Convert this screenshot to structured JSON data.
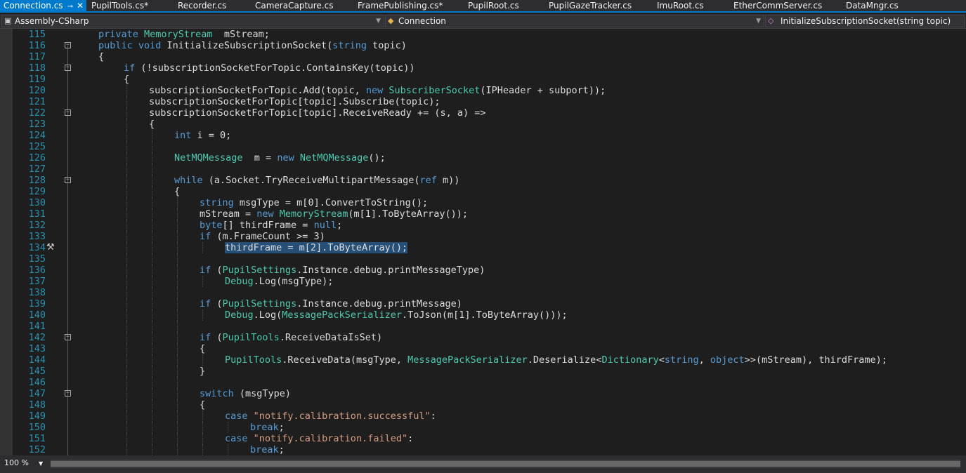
{
  "tabs": [
    {
      "label": "Connection.cs",
      "active": true
    },
    {
      "label": "PupilTools.cs*"
    },
    {
      "label": "Recorder.cs"
    },
    {
      "label": "CameraCapture.cs"
    },
    {
      "label": "FramePublishing.cs*"
    },
    {
      "label": "PupilRoot.cs"
    },
    {
      "label": "PupilGazeTracker.cs"
    },
    {
      "label": "ImuRoot.cs"
    },
    {
      "label": "EtherCommServer.cs"
    },
    {
      "label": "DataMngr.cs"
    }
  ],
  "tab_pin_glyph": "⊸",
  "tab_close_glyph": "✕",
  "navbar": {
    "project": "Assembly-CSharp",
    "class": "Connection",
    "member": "InitializeSubscriptionSocket(string topic)"
  },
  "lines": [
    {
      "n": "115",
      "i": 0,
      "t": [
        [
          "kw",
          "private "
        ],
        [
          "ty",
          "MemoryStream"
        ],
        [
          "",
          "  mStream;"
        ]
      ]
    },
    {
      "n": "116",
      "i": 0,
      "fold": true,
      "t": [
        [
          "kw",
          "public "
        ],
        [
          "kw",
          "void "
        ],
        [
          "",
          "InitializeSubscriptionSocket("
        ],
        [
          "kw",
          "string "
        ],
        [
          "",
          "topic)"
        ]
      ]
    },
    {
      "n": "117",
      "i": 0,
      "t": [
        [
          "",
          "{"
        ]
      ]
    },
    {
      "n": "118",
      "i": 1,
      "fold": true,
      "t": [
        [
          "kw",
          "if "
        ],
        [
          "",
          "(!subscriptionSocketForTopic.ContainsKey(topic))"
        ]
      ]
    },
    {
      "n": "119",
      "i": 1,
      "t": [
        [
          "",
          "{"
        ]
      ]
    },
    {
      "n": "120",
      "i": 2,
      "t": [
        [
          "",
          "subscriptionSocketForTopic.Add(topic, "
        ],
        [
          "kw",
          "new "
        ],
        [
          "ty",
          "SubscriberSocket"
        ],
        [
          "",
          "(IPHeader + subport));"
        ]
      ]
    },
    {
      "n": "121",
      "i": 2,
      "t": [
        [
          "",
          "subscriptionSocketForTopic[topic].Subscribe(topic);"
        ]
      ]
    },
    {
      "n": "122",
      "i": 2,
      "fold": true,
      "t": [
        [
          "",
          "subscriptionSocketForTopic[topic].ReceiveReady += (s, a) =>"
        ]
      ]
    },
    {
      "n": "123",
      "i": 2,
      "t": [
        [
          "",
          "{"
        ]
      ]
    },
    {
      "n": "124",
      "i": 3,
      "t": [
        [
          "kw",
          "int "
        ],
        [
          "",
          "i = 0;"
        ]
      ]
    },
    {
      "n": "125",
      "i": 3,
      "t": []
    },
    {
      "n": "126",
      "i": 3,
      "t": [
        [
          "ty",
          "NetMQMessage"
        ],
        [
          "",
          "  m = "
        ],
        [
          "kw",
          "new "
        ],
        [
          "ty",
          "NetMQMessage"
        ],
        [
          "",
          "();"
        ]
      ]
    },
    {
      "n": "127",
      "i": 3,
      "t": []
    },
    {
      "n": "128",
      "i": 3,
      "fold": true,
      "t": [
        [
          "kw",
          "while "
        ],
        [
          "",
          "(a.Socket.TryReceiveMultipartMessage("
        ],
        [
          "kw",
          "ref "
        ],
        [
          "",
          "m))"
        ]
      ]
    },
    {
      "n": "129",
      "i": 3,
      "t": [
        [
          "",
          "{"
        ]
      ]
    },
    {
      "n": "130",
      "i": 4,
      "t": [
        [
          "kw",
          "string "
        ],
        [
          "",
          "msgType = m[0].ConvertToString();"
        ]
      ]
    },
    {
      "n": "131",
      "i": 4,
      "t": [
        [
          "",
          "mStream = "
        ],
        [
          "kw",
          "new "
        ],
        [
          "ty",
          "MemoryStream"
        ],
        [
          "",
          "(m[1].ToByteArray());"
        ]
      ]
    },
    {
      "n": "132",
      "i": 4,
      "t": [
        [
          "kw",
          "byte"
        ],
        [
          "",
          "[] thirdFrame = "
        ],
        [
          "kw",
          "null"
        ],
        [
          ";"
        ]
      ]
    },
    {
      "n": "133",
      "i": 4,
      "t": [
        [
          "kw",
          "if "
        ],
        [
          "",
          "(m.FrameCount >= 3)"
        ]
      ]
    },
    {
      "n": "134",
      "i": 5,
      "wrench": true,
      "t": [
        [
          "sel",
          "thirdFrame = m[2].ToByteArray();"
        ]
      ]
    },
    {
      "n": "135",
      "i": 4,
      "t": []
    },
    {
      "n": "136",
      "i": 4,
      "t": [
        [
          "kw",
          "if "
        ],
        [
          "",
          "("
        ],
        [
          "ty",
          "PupilSettings"
        ],
        [
          "",
          ".Instance.debug.printMessageType)"
        ]
      ]
    },
    {
      "n": "137",
      "i": 5,
      "t": [
        [
          "ty",
          "Debug"
        ],
        [
          "",
          ".Log(msgType);"
        ]
      ]
    },
    {
      "n": "138",
      "i": 4,
      "t": []
    },
    {
      "n": "139",
      "i": 4,
      "t": [
        [
          "kw",
          "if "
        ],
        [
          "",
          "("
        ],
        [
          "ty",
          "PupilSettings"
        ],
        [
          "",
          ".Instance.debug.printMessage)"
        ]
      ]
    },
    {
      "n": "140",
      "i": 5,
      "t": [
        [
          "ty",
          "Debug"
        ],
        [
          "",
          ".Log("
        ],
        [
          "ty",
          "MessagePackSerializer"
        ],
        [
          "",
          ".ToJson(m[1].ToByteArray()));"
        ]
      ]
    },
    {
      "n": "141",
      "i": 4,
      "t": []
    },
    {
      "n": "142",
      "i": 4,
      "fold": true,
      "t": [
        [
          "kw",
          "if "
        ],
        [
          "",
          "("
        ],
        [
          "ty",
          "PupilTools"
        ],
        [
          "",
          ".ReceiveDataIsSet)"
        ]
      ]
    },
    {
      "n": "143",
      "i": 4,
      "t": [
        [
          "",
          "{"
        ]
      ]
    },
    {
      "n": "144",
      "i": 5,
      "t": [
        [
          "ty",
          "PupilTools"
        ],
        [
          "",
          ".ReceiveData(msgType, "
        ],
        [
          "ty",
          "MessagePackSerializer"
        ],
        [
          "",
          ".Deserialize<"
        ],
        [
          "ty",
          "Dictionary"
        ],
        [
          "",
          "<"
        ],
        [
          "kw",
          "string"
        ],
        [
          "",
          ", "
        ],
        [
          "kw",
          "object"
        ],
        [
          "",
          ">>(mStream), thirdFrame);"
        ]
      ]
    },
    {
      "n": "145",
      "i": 4,
      "t": [
        [
          "",
          "}"
        ]
      ]
    },
    {
      "n": "146",
      "i": 4,
      "t": []
    },
    {
      "n": "147",
      "i": 4,
      "fold": true,
      "t": [
        [
          "kw",
          "switch "
        ],
        [
          "",
          "(msgType)"
        ]
      ]
    },
    {
      "n": "148",
      "i": 4,
      "t": [
        [
          "",
          "{"
        ]
      ]
    },
    {
      "n": "149",
      "i": 5,
      "t": [
        [
          "kw",
          "case "
        ],
        [
          "str",
          "\"notify.calibration.successful\""
        ],
        [
          "",
          ":"
        ]
      ]
    },
    {
      "n": "150",
      "i": 6,
      "t": [
        [
          "kw",
          "break"
        ],
        [
          "",
          ";"
        ]
      ]
    },
    {
      "n": "151",
      "i": 5,
      "t": [
        [
          "kw",
          "case "
        ],
        [
          "str",
          "\"notify.calibration.failed\""
        ],
        [
          "",
          ":"
        ]
      ]
    },
    {
      "n": "152",
      "i": 6,
      "t": [
        [
          "kw",
          "break"
        ],
        [
          "",
          ";"
        ]
      ]
    }
  ],
  "status": {
    "zoom": "100 %"
  },
  "colors": {
    "keyword": "#569cd6",
    "type": "#4ec9b0",
    "string": "#d69d85",
    "text": "#dcdcdc",
    "lineNumber": "#2b91af",
    "selection": "#264f78",
    "accent": "#007acc"
  }
}
